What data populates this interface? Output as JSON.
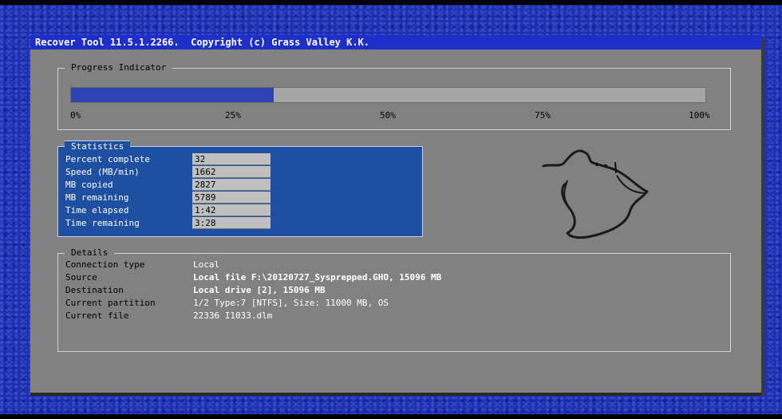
{
  "window": {
    "title": "Recover Tool 11.5.1.2266.  Copyright (c) Grass Valley K.K."
  },
  "progress": {
    "legend": "Progress Indicator",
    "percent": 32,
    "ticks": [
      "0%",
      "25%",
      "50%",
      "75%",
      "100%"
    ]
  },
  "statistics": {
    "legend": "Statistics",
    "rows": [
      {
        "label": "Percent complete",
        "value": "32"
      },
      {
        "label": "Speed (MB/min)",
        "value": "1662"
      },
      {
        "label": "MB copied",
        "value": "2827"
      },
      {
        "label": "MB remaining",
        "value": "5789"
      },
      {
        "label": "Time elapsed",
        "value": "1:42"
      },
      {
        "label": "Time remaining",
        "value": "3:28"
      }
    ]
  },
  "details": {
    "legend": "Details",
    "rows": [
      {
        "label": "Connection type",
        "value": "Local"
      },
      {
        "label": "Source",
        "value": "Local file F:\\20120727_Sysprepped.GHO, 15096 MB"
      },
      {
        "label": "Destination",
        "value": "Local drive [2], 15096 MB"
      },
      {
        "label": "Current partition",
        "value": "1/2 Type:7 [NTFS], Size: 11000 MB, OS"
      },
      {
        "label": "Current file",
        "value": "22336 I1033.dlm"
      }
    ]
  },
  "graphic": {
    "icon": "ghost-icon"
  }
}
